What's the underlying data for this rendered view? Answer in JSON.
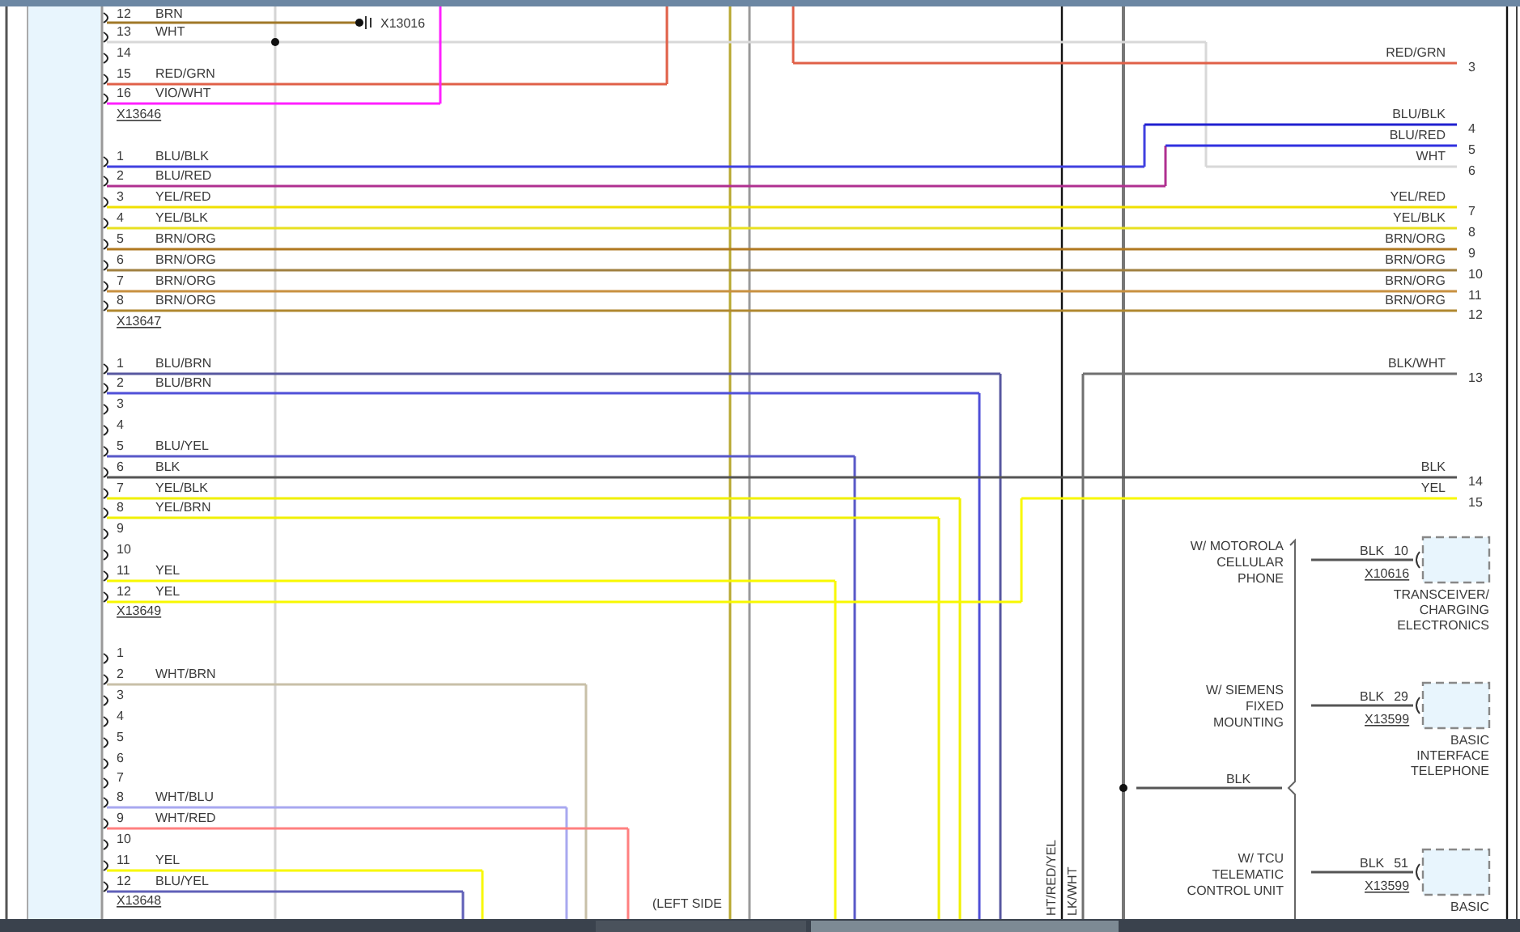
{
  "connectors": [
    {
      "name": "X13646",
      "pins": [
        {
          "pin": "12",
          "wire": "BRN",
          "color": "#a07828"
        },
        {
          "pin": "13",
          "wire": "WHT",
          "color": "#d8d8d8"
        },
        {
          "pin": "14"
        },
        {
          "pin": "15",
          "wire": "RED/GRN",
          "color": "#e06048"
        },
        {
          "pin": "16",
          "wire": "VIO/WHT",
          "color": "#ff20ff"
        }
      ]
    },
    {
      "name": "X13647",
      "pins": [
        {
          "pin": "1",
          "wire": "BLU/BLK",
          "color": "#4040e0"
        },
        {
          "pin": "2",
          "wire": "BLU/RED",
          "color": "#b03090"
        },
        {
          "pin": "3",
          "wire": "YEL/RED",
          "color": "#f0e000"
        },
        {
          "pin": "4",
          "wire": "YEL/BLK",
          "color": "#e8e020"
        },
        {
          "pin": "5",
          "wire": "BRN/ORG",
          "color": "#b07820"
        },
        {
          "pin": "6",
          "wire": "BRN/ORG",
          "color": "#a08040"
        },
        {
          "pin": "7",
          "wire": "BRN/ORG",
          "color": "#c89040"
        },
        {
          "pin": "8",
          "wire": "BRN/ORG",
          "color": "#b08830"
        }
      ]
    },
    {
      "name": "X13649",
      "pins": [
        {
          "pin": "1",
          "wire": "BLU/BRN",
          "color": "#5858a0"
        },
        {
          "pin": "2",
          "wire": "BLU/BRN",
          "color": "#5050d8"
        },
        {
          "pin": "3"
        },
        {
          "pin": "4"
        },
        {
          "pin": "5",
          "wire": "BLU/YEL",
          "color": "#5858c8"
        },
        {
          "pin": "6",
          "wire": "BLK",
          "color": "#555555"
        },
        {
          "pin": "7",
          "wire": "YEL/BLK",
          "color": "#f0f000"
        },
        {
          "pin": "8",
          "wire": "YEL/BRN",
          "color": "#f0f000"
        },
        {
          "pin": "9"
        },
        {
          "pin": "10"
        },
        {
          "pin": "11",
          "wire": "YEL",
          "color": "#f8f800"
        },
        {
          "pin": "12",
          "wire": "YEL",
          "color": "#f8f800"
        }
      ]
    },
    {
      "name": "X13648",
      "pins": [
        {
          "pin": "1"
        },
        {
          "pin": "2",
          "wire": "WHT/BRN",
          "color": "#c8c0a8"
        },
        {
          "pin": "3"
        },
        {
          "pin": "4"
        },
        {
          "pin": "5"
        },
        {
          "pin": "6"
        },
        {
          "pin": "7"
        },
        {
          "pin": "8",
          "wire": "WHT/BLU",
          "color": "#a8a8f0"
        },
        {
          "pin": "9",
          "wire": "WHT/RED",
          "color": "#ff8080"
        },
        {
          "pin": "10"
        },
        {
          "pin": "11",
          "wire": "YEL",
          "color": "#f8f800"
        },
        {
          "pin": "12",
          "wire": "BLU/YEL",
          "color": "#6060b8"
        }
      ]
    }
  ],
  "splice": {
    "name": "X13016"
  },
  "right_pins": [
    {
      "pin": "3",
      "wire": "RED/GRN",
      "color": "#e06048"
    },
    {
      "pin": "4",
      "wire": "BLU/BLK",
      "color": "#2020d0"
    },
    {
      "pin": "5",
      "wire": "BLU/RED",
      "color": "#3030e0"
    },
    {
      "pin": "6",
      "wire": "WHT",
      "color": "#d8d8d8"
    },
    {
      "pin": "7",
      "wire": "YEL/RED",
      "color": "#f0e000"
    },
    {
      "pin": "8",
      "wire": "YEL/BLK",
      "color": "#e8e020"
    },
    {
      "pin": "9",
      "wire": "BRN/ORG",
      "color": "#b07820"
    },
    {
      "pin": "10",
      "wire": "BRN/ORG",
      "color": "#a08040"
    },
    {
      "pin": "11",
      "wire": "BRN/ORG",
      "color": "#c89040"
    },
    {
      "pin": "12",
      "wire": "BRN/ORG",
      "color": "#b08830"
    },
    {
      "pin": "13",
      "wire": "BLK/WHT",
      "color": "#707070"
    },
    {
      "pin": "14",
      "wire": "BLK",
      "color": "#555555"
    },
    {
      "pin": "15",
      "wire": "YEL",
      "color": "#f8f800"
    }
  ],
  "vertical_labels": [
    "HT/RED/YEL",
    "LK/WHT"
  ],
  "ground_wire": "BLK",
  "options": [
    {
      "condition": [
        "W/ MOTOROLA",
        "CELLULAR",
        "PHONE"
      ],
      "wire": "BLK",
      "pin": "10",
      "connector": "X10616",
      "component": [
        "TRANSCEIVER/",
        "CHARGING",
        "ELECTRONICS"
      ]
    },
    {
      "condition": [
        "W/ SIEMENS",
        "FIXED",
        "MOUNTING"
      ],
      "wire": "BLK",
      "pin": "29",
      "connector": "X13599",
      "component": [
        "BASIC",
        "INTERFACE",
        "TELEPHONE"
      ]
    },
    {
      "condition": [
        "W/ TCU",
        "TELEMATIC",
        "CONTROL UNIT"
      ],
      "wire": "BLK",
      "pin": "51",
      "connector": "X13599",
      "component": [
        "BASIC"
      ]
    }
  ],
  "location_note": "(LEFT SIDE"
}
